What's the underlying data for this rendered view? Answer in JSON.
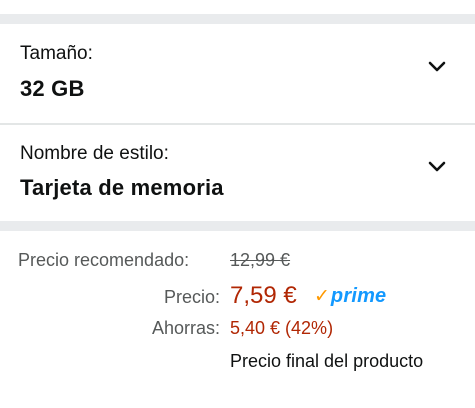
{
  "size": {
    "label": "Tamaño:",
    "value": "32 GB"
  },
  "style": {
    "label": "Nombre de estilo:",
    "value": "Tarjeta de memoria"
  },
  "pricing": {
    "recommended_label": "Precio recomendado:",
    "recommended_value": "12,99 €",
    "price_label": "Precio:",
    "price_value": "7,59 €",
    "prime_label": "prime",
    "savings_label": "Ahorras:",
    "savings_value": "5,40 € (42%)",
    "final_note": "Precio final del producto"
  },
  "icons": {
    "dropdown": "chevron-down-icon",
    "prime_check": "prime-check-icon"
  },
  "colors": {
    "price": "#b12704",
    "prime_blue": "#1399ff",
    "prime_orange": "#ff9900",
    "muted": "#565959"
  }
}
